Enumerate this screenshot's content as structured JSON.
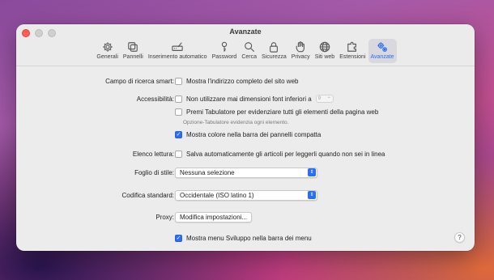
{
  "window": {
    "title": "Avanzate"
  },
  "toolbar": {
    "items": [
      {
        "label": "Generali",
        "icon": "gear-icon"
      },
      {
        "label": "Pannelli",
        "icon": "tabs-icon"
      },
      {
        "label": "Inserimento automatico",
        "icon": "pencil-field-icon"
      },
      {
        "label": "Password",
        "icon": "key-icon"
      },
      {
        "label": "Cerca",
        "icon": "magnifier-icon"
      },
      {
        "label": "Sicurezza",
        "icon": "lock-icon"
      },
      {
        "label": "Privacy",
        "icon": "hand-icon"
      },
      {
        "label": "Siti web",
        "icon": "globe-icon"
      },
      {
        "label": "Estensioni",
        "icon": "puzzle-icon"
      },
      {
        "label": "Avanzate",
        "icon": "gears-icon",
        "active": true
      }
    ],
    "accent_color": "#2b6ef0"
  },
  "settings": {
    "smart_search": {
      "label": "Campo di ricerca smart:",
      "option": "Mostra l'indirizzo completo del sito web",
      "checked": false
    },
    "accessibility": {
      "label": "Accessibilità:",
      "font_option": "Non utilizzare mai dimensioni font inferiori a",
      "font_size": "9",
      "font_checked": false,
      "tab_option": "Premi Tabulatore per evidenziare tutti gli elementi della pagina web",
      "tab_checked": false,
      "tab_hint": "Opzione-Tabulatore evidenzia ogni elemento.",
      "compact_option": "Mostra colore nella barra dei pannelli compatta",
      "compact_checked": true
    },
    "reading_list": {
      "label": "Elenco lettura:",
      "option": "Salva automaticamente gli articoli per leggerli quando non sei in linea",
      "checked": false
    },
    "stylesheet": {
      "label": "Foglio di stile:",
      "value": "Nessuna selezione"
    },
    "encoding": {
      "label": "Codifica standard:",
      "value": "Occidentale (ISO latino 1)"
    },
    "proxy": {
      "label": "Proxy:",
      "button": "Modifica impostazioni..."
    },
    "develop_menu": {
      "option": "Mostra menu Sviluppo nella barra dei menu",
      "checked": true
    }
  },
  "help": {
    "label": "?"
  }
}
